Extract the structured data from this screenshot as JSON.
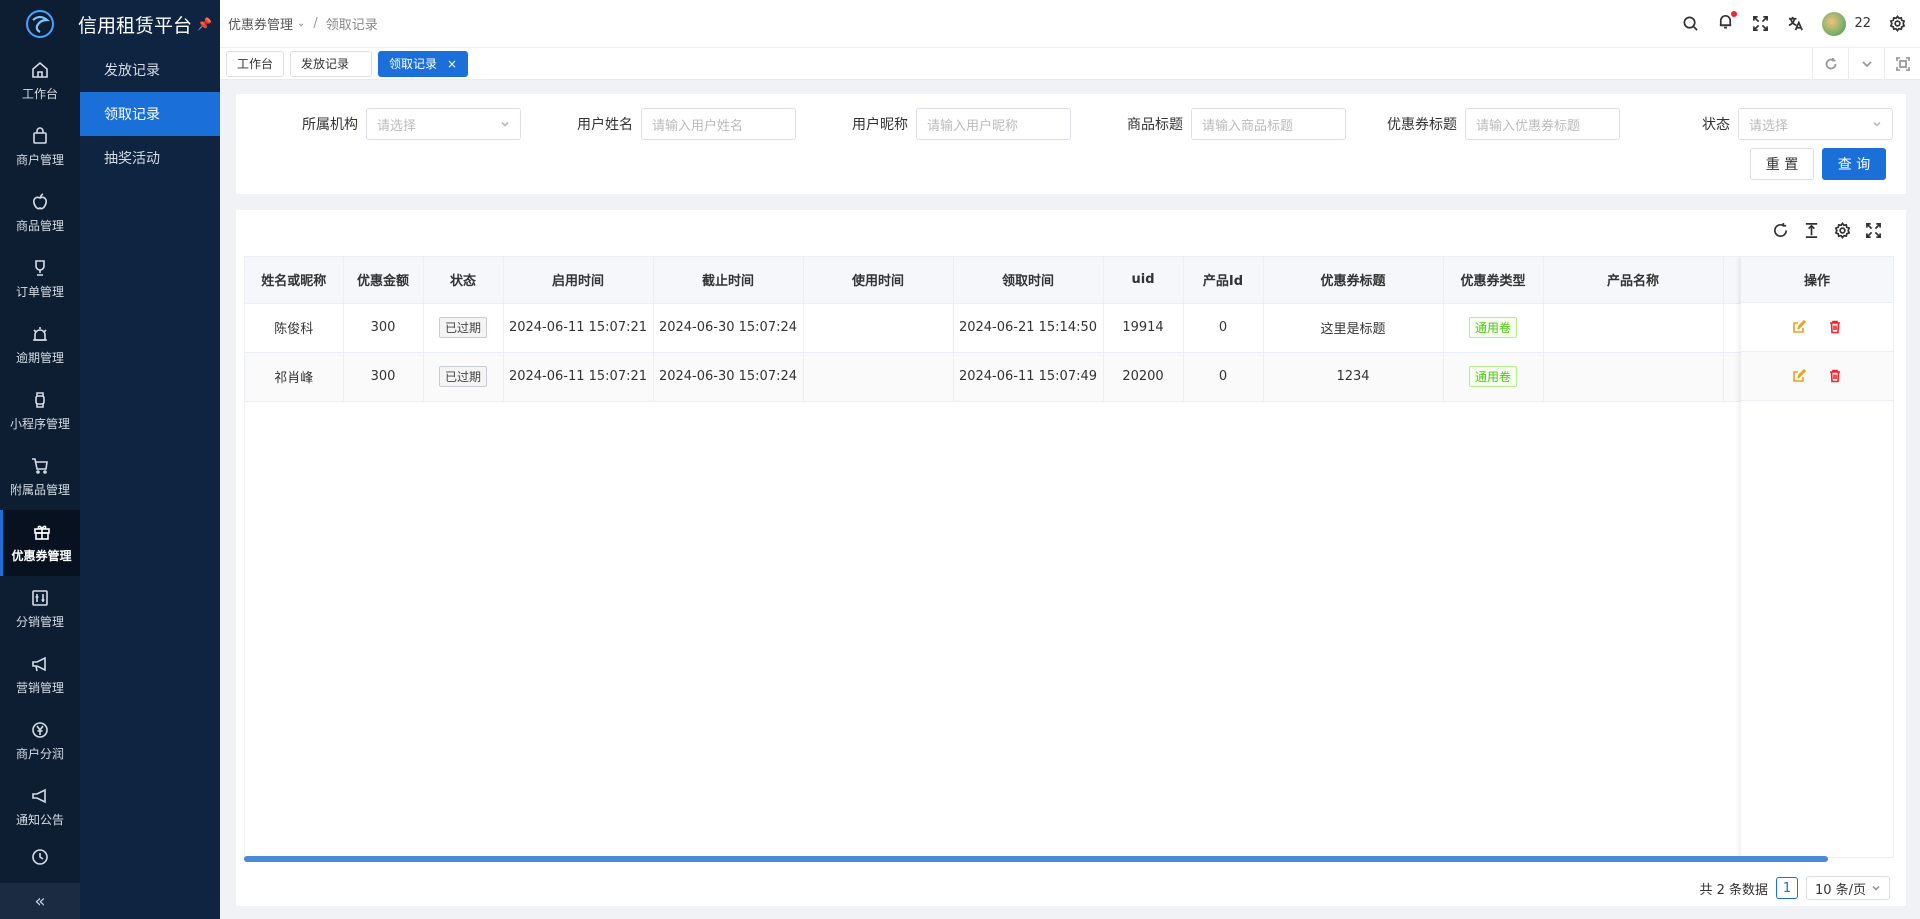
{
  "app": {
    "title": "信用租赁平台"
  },
  "rail": {
    "items": [
      {
        "label": "工作台",
        "icon": "home-icon"
      },
      {
        "label": "商户管理",
        "icon": "bag-icon"
      },
      {
        "label": "商品管理",
        "icon": "apple-icon"
      },
      {
        "label": "订单管理",
        "icon": "trophy-icon"
      },
      {
        "label": "逾期管理",
        "icon": "alarm-icon"
      },
      {
        "label": "小程序管理",
        "icon": "watch-icon"
      },
      {
        "label": "附属品管理",
        "icon": "cart-icon"
      },
      {
        "label": "优惠券管理",
        "icon": "gift-icon"
      },
      {
        "label": "分销管理",
        "icon": "sliders-icon"
      },
      {
        "label": "营销管理",
        "icon": "megaphone-icon"
      },
      {
        "label": "商户分润",
        "icon": "yen-icon"
      },
      {
        "label": "通知公告",
        "icon": "notice-icon"
      }
    ],
    "collapse": "«"
  },
  "subnav": {
    "items": [
      "发放记录",
      "领取记录",
      "抽奖活动"
    ]
  },
  "breadcrumb": {
    "parent": "优惠券管理",
    "sep": "/",
    "current": "领取记录"
  },
  "header": {
    "user": "22"
  },
  "tabs": {
    "items": [
      "工作台",
      "发放记录",
      "领取记录"
    ],
    "close": "×"
  },
  "filters": {
    "org": {
      "label": "所属机构",
      "placeholder": "请选择"
    },
    "username": {
      "label": "用户姓名",
      "placeholder": "请输入用户姓名"
    },
    "nickname": {
      "label": "用户昵称",
      "placeholder": "请输入用户昵称"
    },
    "product_title": {
      "label": "商品标题",
      "placeholder": "请输入商品标题"
    },
    "coupon_title": {
      "label": "优惠券标题",
      "placeholder": "请输入优惠券标题"
    },
    "status": {
      "label": "状态",
      "placeholder": "请选择"
    },
    "reset": "重 置",
    "query": "查 询"
  },
  "table": {
    "columns": [
      "姓名或昵称",
      "优惠金额",
      "状态",
      "启用时间",
      "截止时间",
      "使用时间",
      "领取时间",
      "uid",
      "产品Id",
      "优惠券标题",
      "优惠券类型",
      "产品名称",
      "操作"
    ],
    "rows": [
      {
        "name": "陈俊科",
        "amount": "300",
        "status": "已过期",
        "start": "2024-06-11 15:07:21",
        "end": "2024-06-30 15:07:24",
        "used": "",
        "received": "2024-06-21 15:14:50",
        "uid": "19914",
        "product_id": "0",
        "coupon_title": "这里是标题",
        "coupon_type": "通用卷",
        "product_name": ""
      },
      {
        "name": "祁肖峰",
        "amount": "300",
        "status": "已过期",
        "start": "2024-06-11 15:07:21",
        "end": "2024-06-30 15:07:24",
        "used": "",
        "received": "2024-06-11 15:07:49",
        "uid": "20200",
        "product_id": "0",
        "coupon_title": "1234",
        "coupon_type": "通用卷",
        "product_name": ""
      }
    ]
  },
  "pager": {
    "total": "共 2 条数据",
    "page": "1",
    "size": "10 条/页"
  },
  "colors": {
    "primary": "#1a6fd8",
    "rail_bg": "#0e1e32",
    "danger": "#f5222d",
    "edit": "#f0a020"
  }
}
